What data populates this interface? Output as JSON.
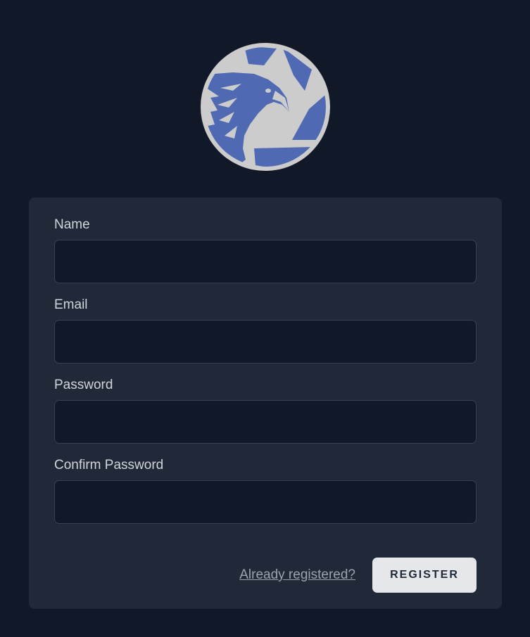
{
  "logo": {
    "icon": "eagle-shutter-logo",
    "ring_color": "#cccccc",
    "blue_color": "#4f69b3"
  },
  "form": {
    "fields": [
      {
        "label": "Name",
        "value": "",
        "type": "text"
      },
      {
        "label": "Email",
        "value": "",
        "type": "email"
      },
      {
        "label": "Password",
        "value": "",
        "type": "password"
      },
      {
        "label": "Confirm Password",
        "value": "",
        "type": "password"
      }
    ],
    "already_registered_link": "Already registered?",
    "register_button": "REGISTER"
  },
  "colors": {
    "page_background": "#111827",
    "card_background": "#1f2937",
    "input_background": "#111827",
    "button_background": "#e5e7eb"
  }
}
